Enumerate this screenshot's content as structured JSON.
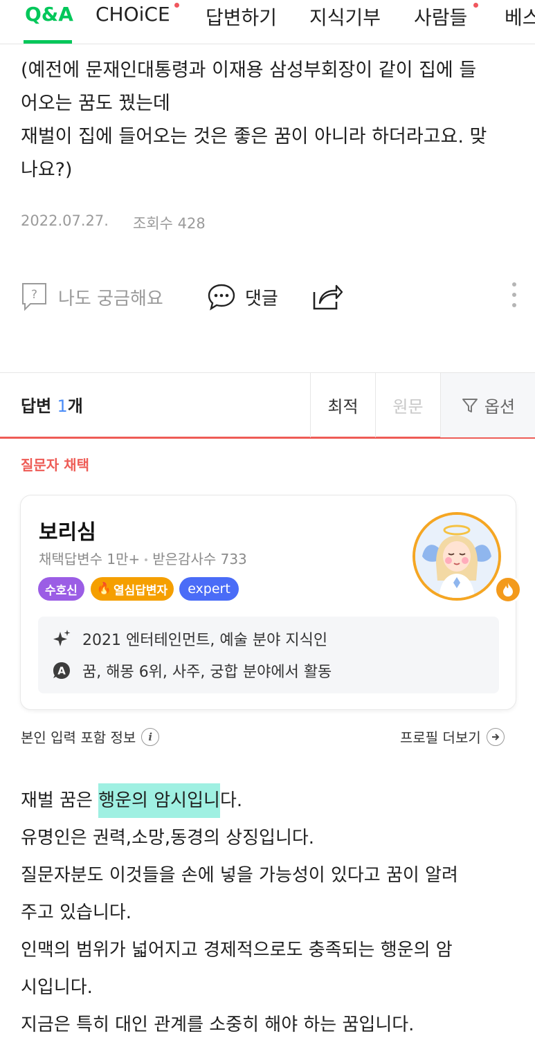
{
  "nav": {
    "items": [
      {
        "label": "Q&A"
      },
      {
        "label": "CHOiCE"
      },
      {
        "label": "답변하기"
      },
      {
        "label": "지식기부"
      },
      {
        "label": "사람들"
      },
      {
        "label": "베스"
      }
    ],
    "accent": "#03c75a",
    "dot_color": "#f0575e"
  },
  "question": {
    "lines": [
      "(예전에 문재인대통령과 이재용 삼성부회장이 같이 집에 들",
      "어오는 꿈도 꿨는데",
      "재벌이 집에 들어오는 것은 좋은 꿈이 아니라 하더라고요. 맞",
      "나요?)"
    ],
    "date": "2022.07.27.",
    "views": "조회수 428"
  },
  "actions": {
    "curious": "나도 궁금해요",
    "comment": "댓글"
  },
  "answers_header": {
    "label_prefix": "답변 ",
    "count": "1",
    "label_suffix": "개",
    "sort_best": "최적",
    "sort_original": "원문",
    "options": "옵션",
    "accent": "#ee5c56"
  },
  "answer": {
    "chosen_label": "질문자 채택",
    "profile": {
      "name": "보리심",
      "stats_adopted": "채택답변수 1만+",
      "stats_thanks": "받은감사수 733",
      "badges": [
        {
          "label": "수호신",
          "color": "#9b5de5"
        },
        {
          "label": "열심답변자",
          "color": "#f59f00"
        },
        {
          "label": "expert",
          "color": "#4a6cf7"
        }
      ],
      "info": [
        {
          "icon": "sparkle-icon",
          "text": "2021 엔터테인먼트, 예술 분야 지식인"
        },
        {
          "icon": "answer-a-icon",
          "text": "꿈, 해몽 6위, 사주, 궁합 분야에서 활동"
        }
      ]
    },
    "self_info": "본인 입력 포함 정보",
    "profile_more": "프로필 더보기",
    "body": {
      "line1_pre": "재벌 꿈은 ",
      "line1_hl": "행운의 암시입니",
      "line1_post": "다.",
      "lines": [
        "유명인은 권력,소망,동경의 상징입니다.",
        "질문자분도 이것들을 손에 넣을 가능성이 있다고 꿈이 알려",
        "주고 있습니다.",
        "인맥의 범위가 넓어지고 경제적으로도 충족되는 행운의 암",
        "시입니다.",
        "지금은 특히 대인 관계를 소중히 해야 하는 꿈입니다."
      ],
      "highlight_color": "#9ff0e2"
    }
  }
}
